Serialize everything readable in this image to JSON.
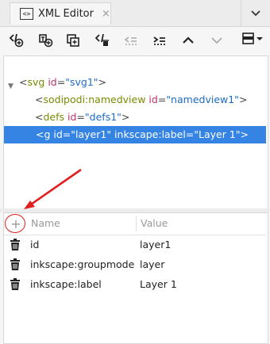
{
  "tab": {
    "label": "XML Editor",
    "close": "×",
    "icon": "xml-editor-icon"
  },
  "tab_menu_icon": "chevron-down-icon",
  "toolbar": {
    "buttons": [
      "new-element-node-icon",
      "new-text-node-icon",
      "duplicate-node-icon",
      "delete-node-icon",
      "unindent-node-icon",
      "indent-node-icon",
      "raise-node-icon",
      "lower-node-icon",
      "layout-menu-icon"
    ]
  },
  "tree": {
    "expander": "▼",
    "nodes": [
      {
        "tag": "svg",
        "attr": "id",
        "value": "\"svg1\"",
        "open": "<",
        "close": ">"
      },
      {
        "tag": "sodipodi:namedview",
        "attr": "id",
        "value": "\"namedview1\"",
        "open": "<",
        "close": ">"
      },
      {
        "tag": "defs",
        "attr": "id",
        "value": "\"defs1\"",
        "open": "<",
        "close": ">"
      },
      {
        "tag": "g",
        "text": "<g id=\"layer1\" inkscape:label=\"Layer 1\">",
        "selected": true
      }
    ]
  },
  "attributes": {
    "add": "+",
    "header_name": "Name",
    "header_value": "Value",
    "rows": [
      {
        "name": "id",
        "value": "layer1"
      },
      {
        "name": "inkscape:groupmode",
        "value": "layer"
      },
      {
        "name": "inkscape:label",
        "value": "Layer 1"
      }
    ]
  },
  "annotation": {
    "arrow_color": "#e02020"
  }
}
